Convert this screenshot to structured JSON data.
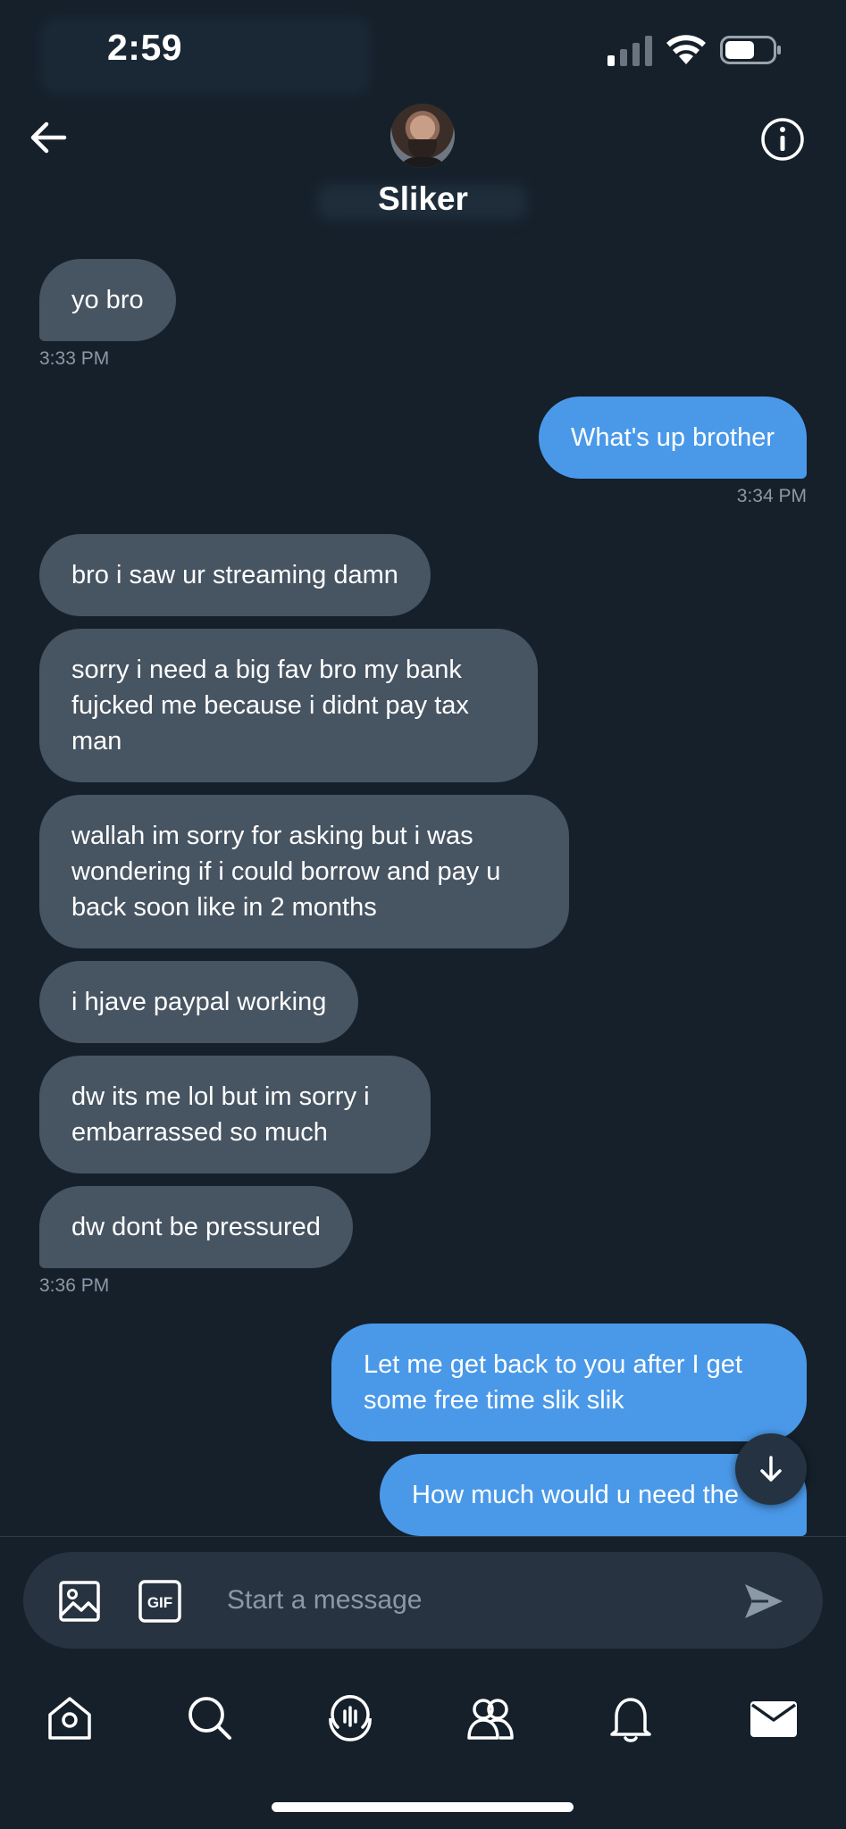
{
  "status_bar": {
    "time": "2:59"
  },
  "header": {
    "contact_name": "Sliker",
    "back_icon": "arrow-left-icon",
    "info_icon": "info-circle-icon"
  },
  "messages": [
    {
      "text": "yo bro",
      "direction": "incoming"
    },
    {
      "timestamp": "3:33 PM"
    },
    {
      "text": "What's up brother",
      "direction": "outgoing"
    },
    {
      "timestamp": "3:34 PM"
    },
    {
      "text": "bro i saw ur streaming damn",
      "direction": "incoming"
    },
    {
      "text": "sorry i need a big fav bro my bank fujcked me because i didnt pay tax man",
      "direction": "incoming"
    },
    {
      "text": "wallah im sorry for asking but i was wondering if i could borrow and pay u back soon like in 2 months",
      "direction": "incoming"
    },
    {
      "text": "i hjave paypal working",
      "direction": "incoming"
    },
    {
      "text": "dw its me lol but im sorry i embarrassed so much",
      "direction": "incoming"
    },
    {
      "text": "dw dont be pressured",
      "direction": "incoming"
    },
    {
      "timestamp": "3:36 PM"
    },
    {
      "text": "Let me get back to you after I get some free time slik slik",
      "direction": "outgoing"
    },
    {
      "text": "How much would u need the",
      "direction": "outgoing"
    }
  ],
  "composer": {
    "placeholder": "Start a message",
    "gif_label": "GIF"
  },
  "bottom_nav": [
    {
      "icon": "home-icon"
    },
    {
      "icon": "search-icon"
    },
    {
      "icon": "spaces-icon"
    },
    {
      "icon": "communities-icon"
    },
    {
      "icon": "notifications-icon"
    },
    {
      "icon": "messages-icon",
      "active": true
    }
  ],
  "colors": {
    "background": "#15202b",
    "incoming_bubble": "#475462",
    "outgoing_bubble": "#4a99e9",
    "timestamp": "#8b98a5",
    "composer": "#273340"
  }
}
